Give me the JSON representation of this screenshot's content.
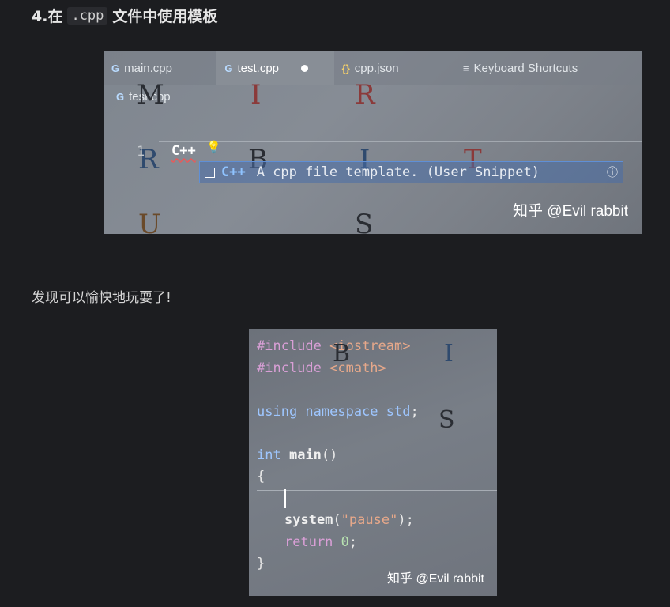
{
  "heading": {
    "prefix": "4.在",
    "code": ".cpp",
    "suffix": "文件中使用模板"
  },
  "screenshot1": {
    "tabs": [
      {
        "icon": "cpp-file-icon",
        "glyph": "G",
        "label": "main.cpp"
      },
      {
        "icon": "cpp-file-icon",
        "glyph": "G",
        "label": "test.cpp"
      },
      {
        "icon": "json-file-icon",
        "glyph": "{}",
        "label": "cpp.json"
      },
      {
        "icon": "keyboard-shortcuts-icon",
        "glyph": "≡",
        "label": "Keyboard Shortcuts"
      }
    ],
    "breadcrumb": "test.cpp",
    "line_number": "1",
    "typed_text": "C++",
    "suggestion": {
      "keyword": "C++",
      "description": "A cpp file template. (User Snippet)",
      "info_glyph": "ⓘ"
    },
    "background_letters": [
      "M",
      "I",
      "R",
      "R",
      "B",
      "I",
      "T",
      "U",
      "S"
    ],
    "watermark": "知乎 @Evil rabbit"
  },
  "paragraph": "发现可以愉快地玩耍了!",
  "screenshot2": {
    "lines": {
      "l1_pp": "#include",
      "l1_inc": " <iostream>",
      "l2_pp": "#include",
      "l2_inc": " <cmath>",
      "l3_kw": "using namespace",
      "l3_ty": " std",
      "l3_end": ";",
      "l4_ty": "int",
      "l4_fn": " main",
      "l4_end": "()",
      "l5": "{",
      "l7_fn": "system",
      "l7_p1": "(",
      "l7_str": "\"pause\"",
      "l7_p2": ");",
      "l8_kw": "return",
      "l8_num": " 0",
      "l8_end": ";",
      "l9": "}"
    },
    "background_letters": [
      "B",
      "I",
      "S"
    ],
    "watermark": "知乎 @Evil rabbit"
  }
}
